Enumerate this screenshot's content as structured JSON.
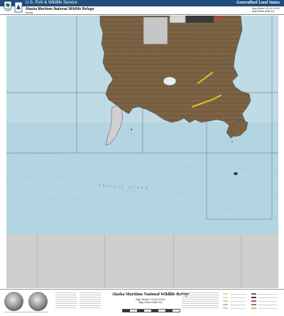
{
  "header": {
    "agency": "U.S. Fish & Wildlife Service",
    "refuge_title": "Alaska Maritime National Wildlife Refuge",
    "region": "Alaska",
    "subtitle": "Generalized Land Status",
    "map_series": "Map Series: LS-XX-XXXX",
    "map_sheet": "Map Sheet: AKM 111"
  },
  "map": {
    "ocean_label": "PACIFIC OCEAN",
    "colors": {
      "ocean": "#bfdbe5",
      "ocean_deep": "#a9cfdc",
      "land_refuge": "#7a6143",
      "land_other": "#c9c9c9",
      "land_dark": "#3a3a3a",
      "highlight": "#e0c21e",
      "boundary": "#4f4f4f",
      "sheet_bg": "#cfcfcf"
    }
  },
  "footer": {
    "title": "Alaska Maritime National Wildlife Refuge",
    "map_series": "Map Series: LS-XX-XXXX",
    "map_sheet": "Map Sheet: AKM 111"
  }
}
